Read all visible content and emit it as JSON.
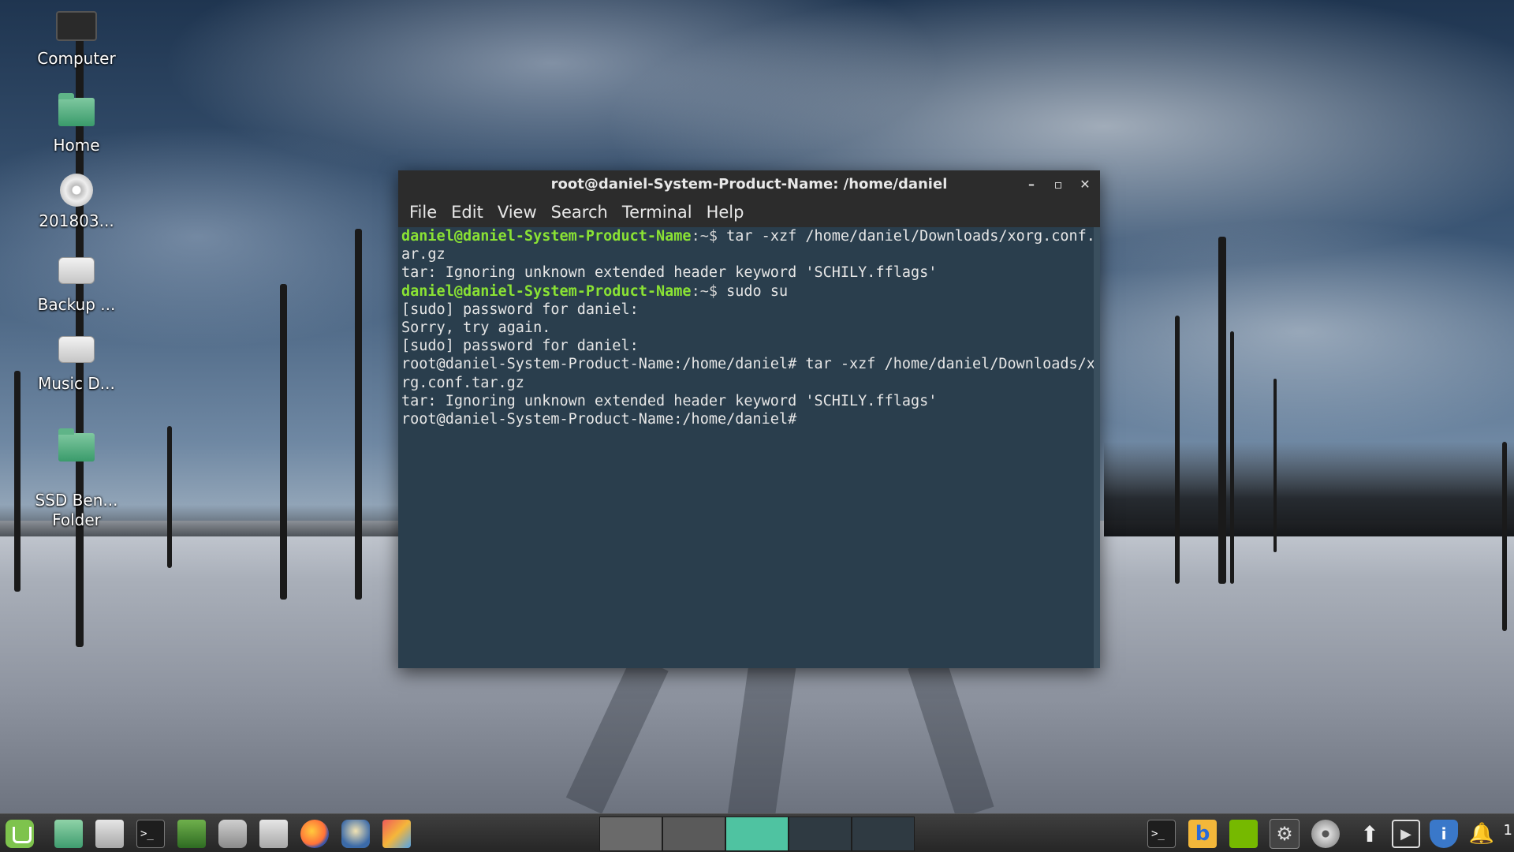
{
  "desktop": {
    "icons": [
      {
        "label": "Computer",
        "icon": "computer-icon"
      },
      {
        "label": "Home",
        "icon": "home-folder-icon"
      },
      {
        "label": "201803...",
        "icon": "dvd-r-icon"
      },
      {
        "label": "Backup ...",
        "icon": "drive-icon"
      },
      {
        "label": "Music D...",
        "icon": "drive-icon"
      },
      {
        "label": "SSD Ben...\nFolder",
        "icon": "folder-icon"
      }
    ]
  },
  "window": {
    "title": "root@daniel-System-Product-Name: /home/daniel",
    "controls": {
      "minimize": "–",
      "maximize": "▫",
      "close": "✕"
    },
    "menu": [
      "File",
      "Edit",
      "View",
      "Search",
      "Terminal",
      "Help"
    ]
  },
  "terminal": {
    "lines": [
      {
        "prompt": "daniel@daniel-System-Product-Name",
        "sep": ":~$ ",
        "text": "tar -xzf /home/daniel/Downloads/xorg.conf.t"
      },
      {
        "text": "ar.gz"
      },
      {
        "text": "tar: Ignoring unknown extended header keyword 'SCHILY.fflags'"
      },
      {
        "prompt": "daniel@daniel-System-Product-Name",
        "sep": ":~$ ",
        "text": "sudo su"
      },
      {
        "text": "[sudo] password for daniel:"
      },
      {
        "text": "Sorry, try again."
      },
      {
        "text": "[sudo] password for daniel:"
      },
      {
        "text": "root@daniel-System-Product-Name:/home/daniel# tar -xzf /home/daniel/Downloads/xo"
      },
      {
        "text": "rg.conf.tar.gz"
      },
      {
        "text": "tar: Ignoring unknown extended header keyword 'SCHILY.fflags'"
      },
      {
        "text": "root@daniel-System-Product-Name:/home/daniel# "
      }
    ]
  },
  "taskbar": {
    "launchers": [
      "linux-mint-menu-icon",
      "files-icon",
      "settings-tool-icon",
      "terminal-icon",
      "system-monitor-icon",
      "camera-icon",
      "tools-icon",
      "firefox-icon",
      "thunderbird-icon",
      "image-viewer-icon"
    ],
    "workspaces": 5,
    "active_workspace": 3,
    "tray": [
      "terminal-icon",
      "bing-icon",
      "nvidia-icon",
      "settings-gear-icon",
      "disc-pro-icon",
      "upload-arrow-icon",
      "media-play-icon",
      "shield-info-icon",
      "notification-bell-icon"
    ],
    "notification_count": "1"
  },
  "colors": {
    "terminal_bg": "#2a3e4d",
    "prompt_green": "#8ae234",
    "titlebar": "#2c2c2c",
    "mint_green": "#7ec34d",
    "active_workspace": "#4fc3a1"
  }
}
